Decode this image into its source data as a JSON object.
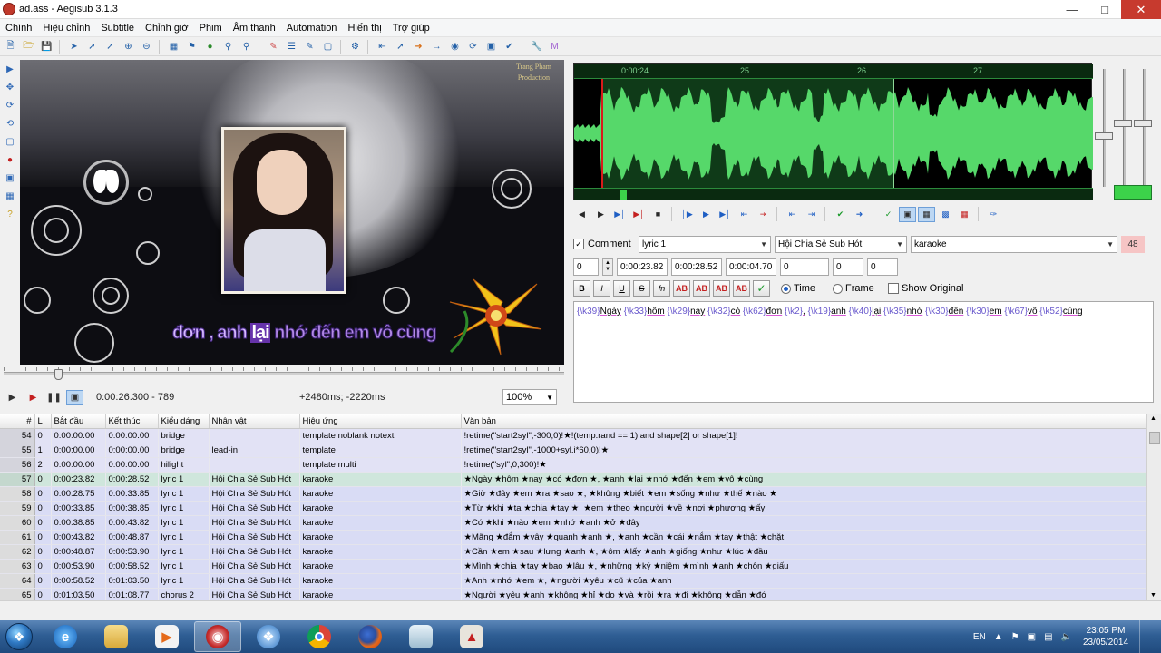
{
  "window": {
    "title": "ad.ass - Aegisub 3.1.3"
  },
  "menu": [
    "Chính",
    "Hiệu chỉnh",
    "Subtitle",
    "Chỉnh giờ",
    "Phim",
    "Âm thanh",
    "Automation",
    "Hiển thị",
    "Trợ giúp"
  ],
  "video": {
    "credit_line1": "Trang Pham",
    "credit_line2": "Production",
    "lyric_done": "đơn , anh",
    "lyric_current": "lại",
    "lyric_rest": "nhớ đến em vô cùng",
    "position": "0:00:26.300 - 789",
    "offset": "+2480ms; -2220ms",
    "zoom": "100%"
  },
  "audio": {
    "ruler_labels": [
      "0:00:24",
      "25",
      "26",
      "27"
    ]
  },
  "edit": {
    "comment_label": "Comment",
    "style": "lyric 1",
    "actor": "Hội Chia Sẻ Sub Hót",
    "effect": "karaoke",
    "char_count": "48",
    "layer": "0",
    "start": "0:00:23.82",
    "end": "0:00:28.52",
    "duration": "0:00:04.70",
    "margin_l": "0",
    "margin_r": "0",
    "margin_v": "0",
    "time_label": "Time",
    "frame_label": "Frame",
    "show_original_label": "Show Original",
    "format_buttons": [
      "B",
      "I",
      "U",
      "S",
      "fn",
      "AB",
      "AB",
      "AB",
      "AB",
      "✓"
    ],
    "text_segments": [
      {
        "tag": "{\\k39}",
        "txt": "Ngày"
      },
      {
        "tag": " {\\k33}",
        "txt": "hôm"
      },
      {
        "tag": " {\\k29}",
        "txt": "nay"
      },
      {
        "tag": " {\\k32}",
        "txt": "có"
      },
      {
        "tag": " {\\k62}",
        "txt": "đơn"
      },
      {
        "tag": " {\\k2}",
        "txt": ","
      },
      {
        "tag": " {\\k19}",
        "txt": "anh"
      },
      {
        "tag": " {\\k40}",
        "txt": "lại"
      },
      {
        "tag": " {\\k35}",
        "txt": "nhớ"
      },
      {
        "tag": " {\\k30}",
        "txt": "đến"
      },
      {
        "tag": " {\\k30}",
        "txt": "em"
      },
      {
        "tag": " {\\k67}",
        "txt": "vô"
      },
      {
        "tag": " {\\k52}",
        "txt": "cùng"
      }
    ]
  },
  "grid": {
    "headers": [
      "#",
      "L",
      "Bắt đầu",
      "Kết thúc",
      "Kiểu dáng",
      "Nhân vật",
      "Hiệu ứng",
      "Văn bản"
    ],
    "rows": [
      {
        "n": "54",
        "l": "0",
        "s": "0:00:00.00",
        "e": "0:00:00.00",
        "style": "bridge",
        "actor": "",
        "effect": "template noblank notext",
        "text": "!retime(\"start2syl\",-300,0)!★!(temp.rand == 1) and shape[2] or shape[1]!",
        "kind": "comment"
      },
      {
        "n": "55",
        "l": "1",
        "s": "0:00:00.00",
        "e": "0:00:00.00",
        "style": "bridge",
        "actor": "lead-in",
        "effect": "template",
        "text": "!retime(\"start2syl\",-1000+syl.i*60,0)!★",
        "kind": "comment"
      },
      {
        "n": "56",
        "l": "2",
        "s": "0:00:00.00",
        "e": "0:00:00.00",
        "style": "hilight",
        "actor": "",
        "effect": "template multi",
        "text": "!retime(\"syl\",0,300)!★",
        "kind": "comment"
      },
      {
        "n": "57",
        "l": "0",
        "s": "0:00:23.82",
        "e": "0:00:28.52",
        "style": "lyric 1",
        "actor": "Hội Chia Sẻ Sub Hót",
        "effect": "karaoke",
        "text": "★Ngày ★hôm ★nay ★có ★đơn ★, ★anh ★lại ★nhớ ★đến ★em ★vô ★cùng",
        "kind": "active"
      },
      {
        "n": "58",
        "l": "0",
        "s": "0:00:28.75",
        "e": "0:00:33.85",
        "style": "lyric 1",
        "actor": "Hội Chia Sẻ Sub Hót",
        "effect": "karaoke",
        "text": "★Giờ ★đây ★em ★ra ★sao ★, ★không ★biết ★em ★sống ★như ★thế ★nào ★",
        "kind": "normal"
      },
      {
        "n": "59",
        "l": "0",
        "s": "0:00:33.85",
        "e": "0:00:38.85",
        "style": "lyric 1",
        "actor": "Hội Chia Sẻ Sub Hót",
        "effect": "karaoke",
        "text": "★Từ ★khi ★ta ★chia ★tay ★, ★em ★theo ★người ★về ★nơi ★phương ★ấy",
        "kind": "normal"
      },
      {
        "n": "60",
        "l": "0",
        "s": "0:00:38.85",
        "e": "0:00:43.82",
        "style": "lyric 1",
        "actor": "Hội Chia Sẻ Sub Hót",
        "effect": "karaoke",
        "text": "★Có ★khi ★nào ★em ★nhớ ★anh ★ở ★đây",
        "kind": "normal"
      },
      {
        "n": "61",
        "l": "0",
        "s": "0:00:43.82",
        "e": "0:00:48.87",
        "style": "lyric 1",
        "actor": "Hội Chia Sẻ Sub Hót",
        "effect": "karaoke",
        "text": "★Mãng ★đắm ★vây ★quanh ★anh ★, ★anh ★cần ★cái ★nắm ★tay ★thật ★chặt",
        "kind": "normal"
      },
      {
        "n": "62",
        "l": "0",
        "s": "0:00:48.87",
        "e": "0:00:53.90",
        "style": "lyric 1",
        "actor": "Hội Chia Sẻ Sub Hót",
        "effect": "karaoke",
        "text": "★Cần ★em ★sau ★lưng ★anh ★, ★ôm ★lấy ★anh ★giống ★như ★lúc ★đầu",
        "kind": "normal"
      },
      {
        "n": "63",
        "l": "0",
        "s": "0:00:53.90",
        "e": "0:00:58.52",
        "style": "lyric 1",
        "actor": "Hội Chia Sẻ Sub Hót",
        "effect": "karaoke",
        "text": "★Mình ★chia ★tay ★bao ★lâu ★, ★những ★kỷ ★niệm ★mình ★anh ★chôn ★giấu",
        "kind": "normal"
      },
      {
        "n": "64",
        "l": "0",
        "s": "0:00:58.52",
        "e": "0:01:03.50",
        "style": "lyric 1",
        "actor": "Hội Chia Sẻ Sub Hót",
        "effect": "karaoke",
        "text": "★Anh ★nhớ ★em ★, ★người ★yêu ★cũ ★của ★anh",
        "kind": "normal"
      },
      {
        "n": "65",
        "l": "0",
        "s": "0:01:03.50",
        "e": "0:01:08.77",
        "style": "chorus 2",
        "actor": "Hội Chia Sẻ Sub Hót",
        "effect": "karaoke",
        "text": "★Người ★yêu ★anh ★không ★hỉ ★do ★và ★rồi ★ra ★đi ★không ★dẫn ★đó",
        "kind": "normal"
      }
    ]
  },
  "taskbar": {
    "lang": "EN",
    "time": "23:05 PM",
    "date": "23/05/2014"
  }
}
